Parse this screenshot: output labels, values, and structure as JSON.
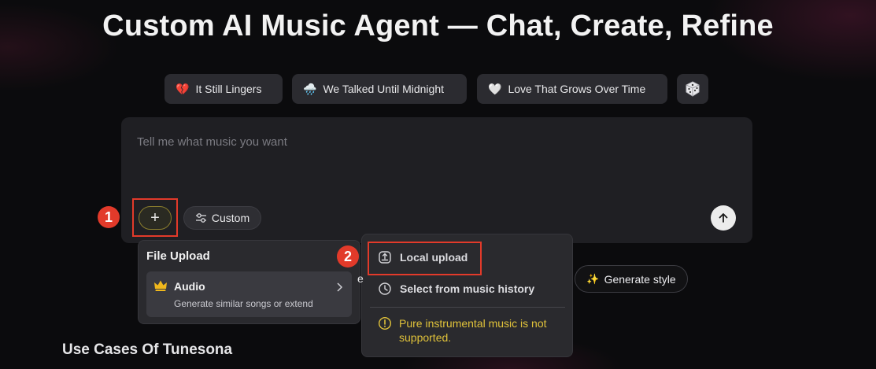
{
  "page": {
    "title": "Custom AI Music Agent — Chat, Create, Refine"
  },
  "prompt_chips": [
    {
      "emoji": "💔",
      "label": "It Still Lingers"
    },
    {
      "emoji": "🌧️",
      "label": "We Talked Until Midnight"
    },
    {
      "emoji": "🤍",
      "label": "Love That Grows Over Time"
    }
  ],
  "dice_icon": "dice-icon",
  "composer": {
    "placeholder": "Tell me what music you want",
    "plus_icon": "+",
    "custom_label": "Custom",
    "send_icon": "arrow-up-icon"
  },
  "annotations": {
    "step1": "1",
    "step2": "2",
    "highlight_color": "#e23a2a"
  },
  "file_upload_panel": {
    "title": "File Upload",
    "item": {
      "label": "Audio",
      "description": "Generate similar songs or extend",
      "icon": "crown-icon"
    }
  },
  "upload_menu": {
    "local_upload": "Local upload",
    "music_history": "Select from music history",
    "warning": "Pure instrumental music is not supported."
  },
  "generate_style": {
    "label": "Generate style",
    "icon": "sparkle-icon"
  },
  "partial_text": "e",
  "section": {
    "heading": "Use Cases Of Tunesona"
  },
  "colors": {
    "background": "#0b0b0d",
    "panel": "#2a2a2e",
    "warning": "#e0c23a",
    "accent_outline": "#8a7d2d"
  }
}
